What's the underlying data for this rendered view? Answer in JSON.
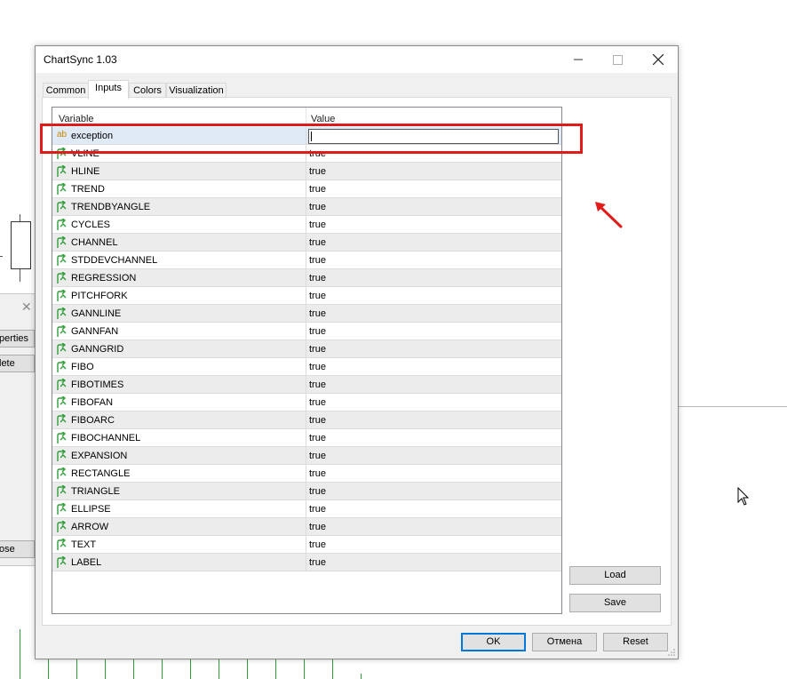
{
  "background": {
    "partial_dialog_buttons": [
      "perties",
      "lete",
      "ose"
    ]
  },
  "dialog": {
    "title": "ChartSync 1.03",
    "tabs": [
      {
        "label": "Common",
        "active": false
      },
      {
        "label": "Inputs",
        "active": true
      },
      {
        "label": "Colors",
        "active": false
      },
      {
        "label": "Visualization",
        "active": false
      }
    ],
    "grid": {
      "headers": {
        "variable": "Variable",
        "value": "Value"
      },
      "string_icon_text": "ab",
      "rows": [
        {
          "variable": "exception",
          "value": "",
          "type": "string",
          "editing": true
        },
        {
          "variable": "VLINE",
          "value": "true",
          "type": "bool"
        },
        {
          "variable": "HLINE",
          "value": "true",
          "type": "bool"
        },
        {
          "variable": "TREND",
          "value": "true",
          "type": "bool"
        },
        {
          "variable": "TRENDBYANGLE",
          "value": "true",
          "type": "bool"
        },
        {
          "variable": "CYCLES",
          "value": "true",
          "type": "bool"
        },
        {
          "variable": "CHANNEL",
          "value": "true",
          "type": "bool"
        },
        {
          "variable": "STDDEVCHANNEL",
          "value": "true",
          "type": "bool"
        },
        {
          "variable": "REGRESSION",
          "value": "true",
          "type": "bool"
        },
        {
          "variable": "PITCHFORK",
          "value": "true",
          "type": "bool"
        },
        {
          "variable": "GANNLINE",
          "value": "true",
          "type": "bool"
        },
        {
          "variable": "GANNFAN",
          "value": "true",
          "type": "bool"
        },
        {
          "variable": "GANNGRID",
          "value": "true",
          "type": "bool"
        },
        {
          "variable": "FIBO",
          "value": "true",
          "type": "bool"
        },
        {
          "variable": "FIBOTIMES",
          "value": "true",
          "type": "bool"
        },
        {
          "variable": "FIBOFAN",
          "value": "true",
          "type": "bool"
        },
        {
          "variable": "FIBOARC",
          "value": "true",
          "type": "bool"
        },
        {
          "variable": "FIBOCHANNEL",
          "value": "true",
          "type": "bool"
        },
        {
          "variable": "EXPANSION",
          "value": "true",
          "type": "bool"
        },
        {
          "variable": "RECTANGLE",
          "value": "true",
          "type": "bool"
        },
        {
          "variable": "TRIANGLE",
          "value": "true",
          "type": "bool"
        },
        {
          "variable": "ELLIPSE",
          "value": "true",
          "type": "bool"
        },
        {
          "variable": "ARROW",
          "value": "true",
          "type": "bool"
        },
        {
          "variable": "TEXT",
          "value": "true",
          "type": "bool"
        },
        {
          "variable": "LABEL",
          "value": "true",
          "type": "bool"
        }
      ]
    },
    "side_buttons": {
      "load": "Load",
      "save": "Save"
    },
    "footer_buttons": {
      "ok": "OK",
      "cancel": "Отмена",
      "reset": "Reset"
    },
    "highlight_color": "#e11a1a",
    "bool_icon_color": "#2e9e3a",
    "string_icon_color": "#c8870a"
  }
}
